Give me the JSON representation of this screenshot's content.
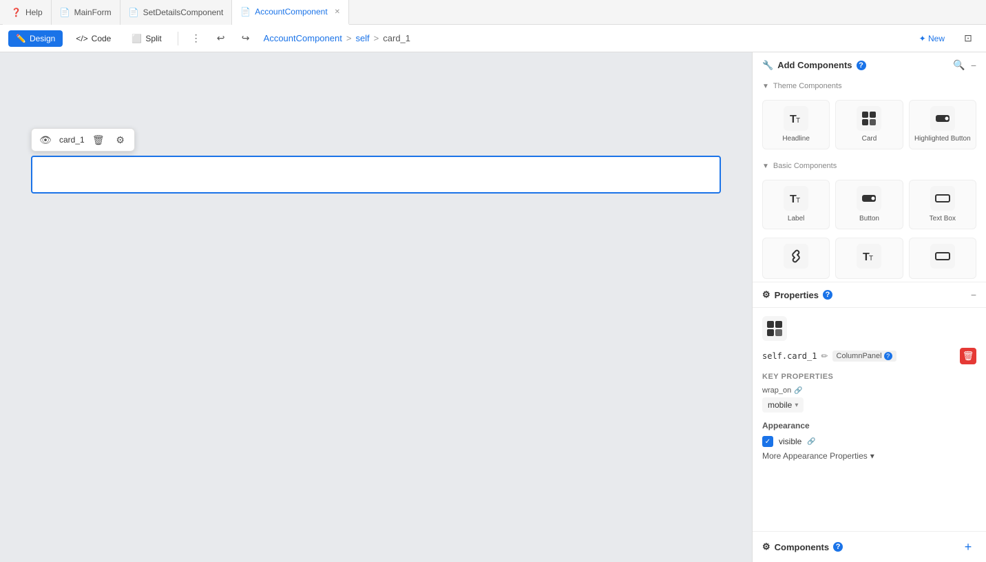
{
  "tabs": [
    {
      "id": "help",
      "label": "Help",
      "icon": "❓",
      "active": false,
      "closeable": false
    },
    {
      "id": "mainform",
      "label": "MainForm",
      "icon": "📄",
      "active": false,
      "closeable": false
    },
    {
      "id": "setdetails",
      "label": "SetDetailsComponent",
      "icon": "📄",
      "active": false,
      "closeable": false
    },
    {
      "id": "account",
      "label": "AccountComponent",
      "icon": "📄",
      "active": true,
      "closeable": true
    }
  ],
  "toolbar": {
    "design_label": "Design",
    "code_label": "Code",
    "split_label": "Split",
    "new_label": "✦ New"
  },
  "breadcrumb": {
    "root": "AccountComponent",
    "sep1": ">",
    "part1": "self",
    "sep2": ">",
    "part2": "card_1"
  },
  "float_toolbar": {
    "card_label": "card_1"
  },
  "add_components": {
    "title": "Add Components",
    "search_icon": "🔍",
    "collapse_icon": "−",
    "theme_section": "Theme Components",
    "basic_section": "Basic Components",
    "theme_items": [
      {
        "id": "headline",
        "label": "Headline",
        "icon": "𝕋"
      },
      {
        "id": "card",
        "label": "Card",
        "icon": "⊞"
      },
      {
        "id": "highlighted-button",
        "label": "Highlighted Button",
        "icon": "🖱"
      }
    ],
    "basic_items": [
      {
        "id": "label",
        "label": "Label",
        "icon": "𝕋"
      },
      {
        "id": "button",
        "label": "Button",
        "icon": "🖱"
      },
      {
        "id": "text-box",
        "label": "Text Box",
        "icon": "▭"
      }
    ],
    "more_items": [
      {
        "id": "link",
        "label": "",
        "icon": "🔗"
      },
      {
        "id": "text2",
        "label": "",
        "icon": "𝕋"
      },
      {
        "id": "input2",
        "label": "",
        "icon": "▭"
      }
    ]
  },
  "properties": {
    "title": "Properties",
    "help_icon": "?",
    "collapse_icon": "−",
    "component_type": "ColumnPanel",
    "component_name": "self.card_1",
    "help_badge": "?",
    "key_properties_label": "Key Properties",
    "wrap_on_label": "wrap_on",
    "wrap_on_value": "mobile",
    "appearance_label": "Appearance",
    "visible_label": "visible",
    "more_appearance_label": "More Appearance Properties"
  },
  "components_bottom": {
    "title": "Components",
    "help_icon": "?"
  }
}
